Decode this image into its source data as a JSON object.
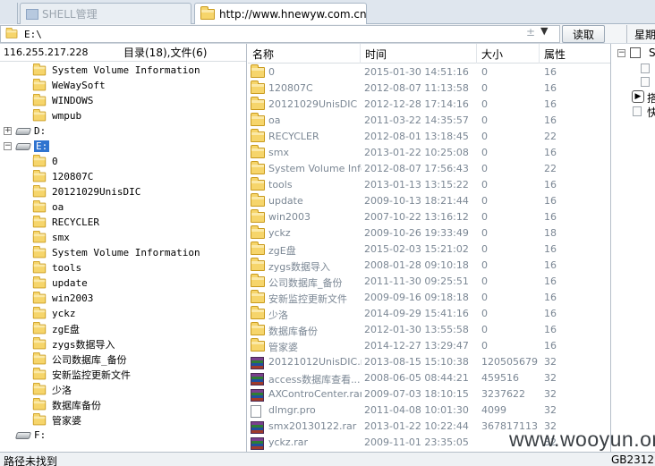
{
  "tabs": [
    {
      "label": "SHELL管理",
      "active": false
    },
    {
      "label": "http://www.hnewyw.com.cn/Us...",
      "active": true
    }
  ],
  "address": {
    "path": "E:\\",
    "button_read": "读取",
    "extra_button": "星期"
  },
  "left_panel": {
    "ip": "116.255.217.228",
    "summary": "目录(18),文件(6)",
    "tree": [
      {
        "label": "System Volume Information",
        "type": "folder"
      },
      {
        "label": "WeWaySoft",
        "type": "folder"
      },
      {
        "label": "WINDOWS",
        "type": "folder"
      },
      {
        "label": "wmpub",
        "type": "folder"
      },
      {
        "label": "D:",
        "type": "drive",
        "expander": "+"
      },
      {
        "label": "E:",
        "type": "drive",
        "expander": "-",
        "selected": true
      },
      {
        "label": "0",
        "type": "folder"
      },
      {
        "label": "120807C",
        "type": "folder"
      },
      {
        "label": "20121029UnisDIC",
        "type": "folder"
      },
      {
        "label": "oa",
        "type": "folder"
      },
      {
        "label": "RECYCLER",
        "type": "folder"
      },
      {
        "label": "smx",
        "type": "folder"
      },
      {
        "label": "System Volume Information",
        "type": "folder"
      },
      {
        "label": "tools",
        "type": "folder"
      },
      {
        "label": "update",
        "type": "folder"
      },
      {
        "label": "win2003",
        "type": "folder"
      },
      {
        "label": "yckz",
        "type": "folder"
      },
      {
        "label": "zgE盘",
        "type": "folder"
      },
      {
        "label": "zygs数据导入",
        "type": "folder"
      },
      {
        "label": "公司数据库_备份",
        "type": "folder"
      },
      {
        "label": "安新监控更新文件",
        "type": "folder"
      },
      {
        "label": "少洛",
        "type": "folder"
      },
      {
        "label": "数据库备份",
        "type": "folder"
      },
      {
        "label": "管家婆",
        "type": "folder"
      },
      {
        "label": "F:",
        "type": "drive"
      }
    ]
  },
  "file_list": {
    "columns": [
      "名称",
      "时间",
      "大小",
      "属性"
    ],
    "rows": [
      {
        "name": "0",
        "time": "2015-01-30 14:51:16",
        "size": "0",
        "attr": "16",
        "icon": "folder"
      },
      {
        "name": "120807C",
        "time": "2012-08-07 11:13:58",
        "size": "0",
        "attr": "16",
        "icon": "folder"
      },
      {
        "name": "20121029UnisDIC",
        "time": "2012-12-28 17:14:16",
        "size": "0",
        "attr": "16",
        "icon": "folder"
      },
      {
        "name": "oa",
        "time": "2011-03-22 14:35:57",
        "size": "0",
        "attr": "16",
        "icon": "folder"
      },
      {
        "name": "RECYCLER",
        "time": "2012-08-01 13:18:45",
        "size": "0",
        "attr": "22",
        "icon": "folder"
      },
      {
        "name": "smx",
        "time": "2013-01-22 10:25:08",
        "size": "0",
        "attr": "16",
        "icon": "folder"
      },
      {
        "name": "System Volume Info...",
        "time": "2012-08-07 17:56:43",
        "size": "0",
        "attr": "22",
        "icon": "folder"
      },
      {
        "name": "tools",
        "time": "2013-01-13 13:15:22",
        "size": "0",
        "attr": "16",
        "icon": "folder"
      },
      {
        "name": "update",
        "time": "2009-10-13 18:21:44",
        "size": "0",
        "attr": "16",
        "icon": "folder"
      },
      {
        "name": "win2003",
        "time": "2007-10-22 13:16:12",
        "size": "0",
        "attr": "16",
        "icon": "folder"
      },
      {
        "name": "yckz",
        "time": "2009-10-26 19:33:49",
        "size": "0",
        "attr": "18",
        "icon": "folder"
      },
      {
        "name": "zgE盘",
        "time": "2015-02-03 15:21:02",
        "size": "0",
        "attr": "16",
        "icon": "folder"
      },
      {
        "name": "zygs数据导入",
        "time": "2008-01-28 09:10:18",
        "size": "0",
        "attr": "16",
        "icon": "folder"
      },
      {
        "name": "公司数据库_备份",
        "time": "2011-11-30 09:25:51",
        "size": "0",
        "attr": "16",
        "icon": "folder"
      },
      {
        "name": "安新监控更新文件",
        "time": "2009-09-16 09:18:18",
        "size": "0",
        "attr": "16",
        "icon": "folder"
      },
      {
        "name": "少洛",
        "time": "2014-09-29 15:41:16",
        "size": "0",
        "attr": "16",
        "icon": "folder"
      },
      {
        "name": "数据库备份",
        "time": "2012-01-30 13:55:58",
        "size": "0",
        "attr": "16",
        "icon": "folder"
      },
      {
        "name": "管家婆",
        "time": "2014-12-27 13:29:47",
        "size": "0",
        "attr": "16",
        "icon": "folder"
      },
      {
        "name": "20121012UnisDIC.rar",
        "time": "2013-08-15 15:10:38",
        "size": "120505679",
        "attr": "32",
        "icon": "rar"
      },
      {
        "name": "access数据库查看...",
        "time": "2008-06-05 08:44:21",
        "size": "459516",
        "attr": "32",
        "icon": "rar"
      },
      {
        "name": "AXControCenter.rar",
        "time": "2009-07-03 18:10:15",
        "size": "3237622",
        "attr": "32",
        "icon": "rar"
      },
      {
        "name": "dlmgr.pro",
        "time": "2011-04-08 10:01:30",
        "size": "4099",
        "attr": "32",
        "icon": "file"
      },
      {
        "name": "smx20130122.rar",
        "time": "2013-01-22 10:22:44",
        "size": "367817113",
        "attr": "32",
        "icon": "rar"
      },
      {
        "name": "yckz.rar",
        "time": "2009-11-01 23:35:05",
        "size": "",
        "attr": "32",
        "icon": "rar"
      }
    ]
  },
  "right_panel": {
    "label_top": "SI",
    "label_mid1": "搭",
    "label_mid2": "快"
  },
  "status": {
    "text": "路径未找到",
    "encoding": "GB2312"
  },
  "watermark": "www.wooyun.org"
}
